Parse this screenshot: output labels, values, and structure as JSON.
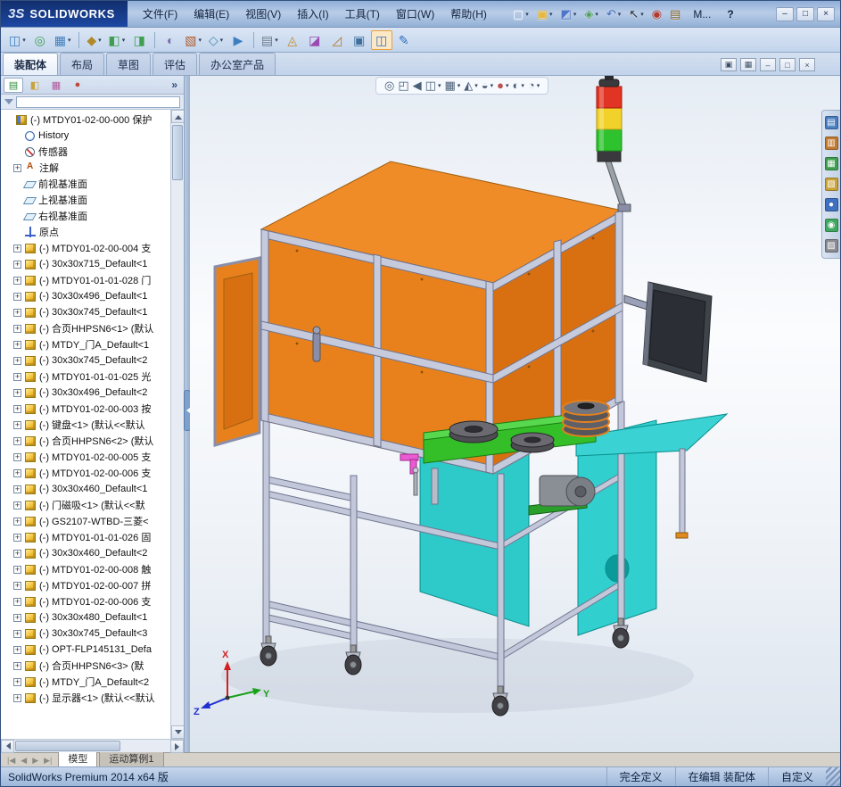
{
  "titlebar": {
    "logo_prefix": "3S",
    "logo_text": "SOLIDWORKS",
    "menus": [
      "文件(F)",
      "编辑(E)",
      "视图(V)",
      "插入(I)",
      "工具(T)",
      "窗口(W)",
      "帮助(H)"
    ],
    "quick_buttons": [
      {
        "name": "new-document",
        "glyph": "▢",
        "color": "#f8fbff",
        "caret": true
      },
      {
        "name": "open-document",
        "glyph": "▣",
        "color": "#e8b83a",
        "caret": true
      },
      {
        "name": "save-document",
        "glyph": "◩",
        "color": "#4f74c8",
        "caret": true
      },
      {
        "name": "export-document",
        "glyph": "◈",
        "color": "#4f9e5a",
        "caret": true
      },
      {
        "name": "undo",
        "glyph": "↶",
        "color": "#3f69b8",
        "caret": true
      },
      {
        "name": "select",
        "glyph": "↖",
        "color": "#2c2c2c",
        "caret": true
      },
      {
        "name": "rebuild",
        "glyph": "◉",
        "color": "#b23a2f",
        "caret": false
      },
      {
        "name": "file-properties",
        "glyph": "▤",
        "color": "#8a6a2a",
        "caret": false
      }
    ],
    "search_text": "M...",
    "help_label": "?",
    "window_buttons": [
      {
        "name": "minimize",
        "glyph": "–"
      },
      {
        "name": "maximize",
        "glyph": "□"
      },
      {
        "name": "close",
        "glyph": "×"
      }
    ]
  },
  "toolbar": {
    "items": [
      {
        "name": "insert-components",
        "glyph": "◫",
        "color": "#3f7fbf",
        "caret": true
      },
      {
        "name": "mate",
        "glyph": "◎",
        "color": "#3f9e4f",
        "caret": false
      },
      {
        "name": "linear-component-pattern",
        "glyph": "▦",
        "color": "#3f7fbf",
        "caret": true
      },
      {
        "sep": true
      },
      {
        "name": "smart-fasteners",
        "glyph": "◆",
        "color": "#b08a2a",
        "caret": true
      },
      {
        "name": "move-component",
        "glyph": "◧",
        "color": "#3f9e4f",
        "caret": true
      },
      {
        "name": "rotate-component",
        "glyph": "◨",
        "color": "#3f9e4f",
        "caret": false
      },
      {
        "sep": true
      },
      {
        "name": "show-hidden-components",
        "glyph": "◐",
        "color": "#7a6aae",
        "caret": false
      },
      {
        "name": "assembly-features",
        "glyph": "▧",
        "color": "#b05a2a",
        "caret": true
      },
      {
        "name": "reference-geometry",
        "glyph": "◇",
        "color": "#4a8ab0",
        "caret": true
      },
      {
        "name": "new-motion-study",
        "glyph": "▶",
        "color": "#3f7fbf",
        "caret": false
      },
      {
        "sep": true
      },
      {
        "name": "bill-of-materials",
        "glyph": "▤",
        "color": "#6a7a8a",
        "caret": true
      },
      {
        "name": "exploded-view",
        "glyph": "◬",
        "color": "#c08a2a",
        "caret": false
      },
      {
        "name": "interference-detection",
        "glyph": "◪",
        "color": "#9a4ab0",
        "caret": false
      },
      {
        "name": "measure",
        "glyph": "◿",
        "color": "#b07a2a",
        "caret": false
      },
      {
        "name": "mass-properties",
        "glyph": "▣",
        "color": "#3f6f9f",
        "caret": false
      },
      {
        "name": "section-view",
        "glyph": "◫",
        "color": "#2c6fc0",
        "caret": false,
        "active": true
      },
      {
        "name": "sketch",
        "glyph": "✎",
        "color": "#2c6fc0",
        "caret": false
      }
    ]
  },
  "command_tabs": [
    {
      "label": "装配体",
      "active": true
    },
    {
      "label": "布局",
      "active": false
    },
    {
      "label": "草图",
      "active": false
    },
    {
      "label": "评估",
      "active": false
    },
    {
      "label": "办公室产品",
      "active": false
    }
  ],
  "doc_window_buttons": [
    {
      "name": "tile-windows",
      "glyph": "▣"
    },
    {
      "name": "cascade-windows",
      "glyph": "▦"
    },
    {
      "name": "minimize-document",
      "glyph": "–"
    },
    {
      "name": "restore-document",
      "glyph": "□"
    },
    {
      "name": "close-document",
      "glyph": "×"
    }
  ],
  "left_panel": {
    "tabs": [
      {
        "name": "featuremanager-tab",
        "glyph": "▤",
        "color": "#2f8f3f",
        "active": true
      },
      {
        "name": "propertymanager-tab",
        "glyph": "◧",
        "color": "#caa23a",
        "active": false
      },
      {
        "name": "configurationmanager-tab",
        "glyph": "▦",
        "color": "#b05a9a",
        "active": false
      },
      {
        "name": "displaymanager-tab",
        "glyph": "●",
        "color": "#c04a3a",
        "active": false
      }
    ],
    "chevron": "»",
    "filter_value": ""
  },
  "tree": {
    "expander_glyph": "+",
    "items": [
      {
        "label": "(-) MTDY01-02-00-000 保护",
        "icon": "root",
        "exp": null,
        "level": 0
      },
      {
        "label": "History",
        "icon": "history",
        "exp": null,
        "level": 1
      },
      {
        "label": "传感器",
        "icon": "sensors",
        "exp": null,
        "level": 1
      },
      {
        "label": "注解",
        "icon": "annotations",
        "exp": "+",
        "level": 1
      },
      {
        "label": "前视基准面",
        "icon": "plane",
        "exp": null,
        "level": 1
      },
      {
        "label": "上视基准面",
        "icon": "plane",
        "exp": null,
        "level": 1
      },
      {
        "label": "右视基准面",
        "icon": "plane",
        "exp": null,
        "level": 1
      },
      {
        "label": "原点",
        "icon": "origin",
        "exp": null,
        "level": 1
      },
      {
        "label": "(-) MTDY01-02-00-004 支",
        "icon": "component",
        "exp": "+",
        "level": 1
      },
      {
        "label": "(-) 30x30x715_Default<1",
        "icon": "component",
        "exp": "+",
        "level": 1
      },
      {
        "label": "(-) MTDY01-01-01-028 门",
        "icon": "component",
        "exp": "+",
        "level": 1
      },
      {
        "label": "(-) 30x30x496_Default<1",
        "icon": "component",
        "exp": "+",
        "level": 1
      },
      {
        "label": "(-) 30x30x745_Default<1",
        "icon": "component",
        "exp": "+",
        "level": 1
      },
      {
        "label": "(-) 合页HHPSN6<1> (默认",
        "icon": "component",
        "exp": "+",
        "level": 1
      },
      {
        "label": "(-) MTDY_门A_Default<1",
        "icon": "component",
        "exp": "+",
        "level": 1
      },
      {
        "label": "(-) 30x30x745_Default<2",
        "icon": "component",
        "exp": "+",
        "level": 1
      },
      {
        "label": "(-) MTDY01-01-01-025 光",
        "icon": "component",
        "exp": "+",
        "level": 1
      },
      {
        "label": "(-) 30x30x496_Default<2",
        "icon": "component",
        "exp": "+",
        "level": 1
      },
      {
        "label": "(-) MTDY01-02-00-003 按",
        "icon": "component",
        "exp": "+",
        "level": 1
      },
      {
        "label": "(-) 键盘<1> (默认<<默认",
        "icon": "component",
        "exp": "+",
        "level": 1
      },
      {
        "label": "(-) 合页HHPSN6<2> (默认",
        "icon": "component",
        "exp": "+",
        "level": 1
      },
      {
        "label": "(-) MTDY01-02-00-005 支",
        "icon": "component",
        "exp": "+",
        "level": 1
      },
      {
        "label": "(-) MTDY01-02-00-006 支",
        "icon": "component",
        "exp": "+",
        "level": 1
      },
      {
        "label": "(-) 30x30x460_Default<1",
        "icon": "component",
        "exp": "+",
        "level": 1
      },
      {
        "label": "(-) 门磁吸<1> (默认<<默",
        "icon": "component",
        "exp": "+",
        "level": 1
      },
      {
        "label": "(-) GS2107-WTBD-三菱<",
        "icon": "component",
        "exp": "+",
        "level": 1
      },
      {
        "label": "(-) MTDY01-01-01-026 固",
        "icon": "component",
        "exp": "+",
        "level": 1
      },
      {
        "label": "(-) 30x30x460_Default<2",
        "icon": "component",
        "exp": "+",
        "level": 1
      },
      {
        "label": "(-) MTDY01-02-00-008 触",
        "icon": "component",
        "exp": "+",
        "level": 1
      },
      {
        "label": "(-) MTDY01-02-00-007 拼",
        "icon": "component",
        "exp": "+",
        "level": 1
      },
      {
        "label": "(-) MTDY01-02-00-006 支",
        "icon": "component",
        "exp": "+",
        "level": 1
      },
      {
        "label": "(-) 30x30x480_Default<1",
        "icon": "component",
        "exp": "+",
        "level": 1
      },
      {
        "label": "(-) 30x30x745_Default<3",
        "icon": "component",
        "exp": "+",
        "level": 1
      },
      {
        "label": "(-) OPT-FLP145131_Defa",
        "icon": "component",
        "exp": "+",
        "level": 1
      },
      {
        "label": "(-) 合页HHPSN6<3> (默",
        "icon": "component",
        "exp": "+",
        "level": 1
      },
      {
        "label": "(-) MTDY_门A_Default<2",
        "icon": "component",
        "exp": "+",
        "level": 1
      },
      {
        "label": "(-) 显示器<1> (默认<<默认",
        "icon": "component",
        "exp": "+",
        "level": 1
      }
    ]
  },
  "viewport": {
    "headsup": [
      {
        "name": "zoom-to-fit",
        "glyph": "◎",
        "caret": false
      },
      {
        "name": "zoom-to-area",
        "glyph": "◰",
        "caret": false
      },
      {
        "name": "previous-view",
        "glyph": "◀",
        "caret": false
      },
      {
        "name": "section-view",
        "glyph": "◫",
        "caret": true
      },
      {
        "name": "view-orientation",
        "glyph": "▦",
        "caret": true
      },
      {
        "name": "display-style",
        "glyph": "◭",
        "caret": true
      },
      {
        "name": "hide-show-items",
        "glyph": "◒",
        "caret": true
      },
      {
        "name": "edit-appearance",
        "glyph": "●",
        "color": "#c05050",
        "caret": true
      },
      {
        "name": "apply-scene",
        "glyph": "◐",
        "caret": true
      },
      {
        "name": "view-settings",
        "glyph": "◔",
        "caret": true
      }
    ],
    "task_pane": [
      {
        "name": "solidworks-resources",
        "glyph": "▤",
        "color": "#4a7ec0"
      },
      {
        "name": "design-library",
        "glyph": "▥",
        "color": "#c07a30"
      },
      {
        "name": "file-explorer",
        "glyph": "▦",
        "color": "#3f9e4f"
      },
      {
        "name": "view-palette",
        "glyph": "▧",
        "color": "#caa23a"
      },
      {
        "name": "appearances-scenes",
        "glyph": "●",
        "color": "#3f6fbf"
      },
      {
        "name": "custom-properties",
        "glyph": "◉",
        "color": "#40a860"
      },
      {
        "name": "document-recovery",
        "glyph": "▨",
        "color": "#8a8a92"
      }
    ],
    "triad": {
      "x": "X",
      "y": "Y",
      "z": "Z"
    },
    "colors": {
      "frame": "#c3c7da",
      "enclosure_orange": "#e8821e",
      "cabinet_cyan": "#2ec9c9",
      "conveyor_green": "#34bf28",
      "tower_red": "#e23424",
      "tower_yellow": "#f2d22a",
      "tower_green": "#2ec22e",
      "monitor_gray": "#3f444b"
    }
  },
  "doc_area": {
    "nav": [
      "|◀",
      "◀",
      "▶",
      "▶|"
    ],
    "tabs": [
      {
        "label": "模型",
        "active": true
      },
      {
        "label": "运动算例1",
        "active": false
      }
    ]
  },
  "statusbar": {
    "left": "SolidWorks Premium 2014 x64 版",
    "segments": [
      "完全定义",
      "在编辑 装配体",
      "自定义"
    ]
  }
}
